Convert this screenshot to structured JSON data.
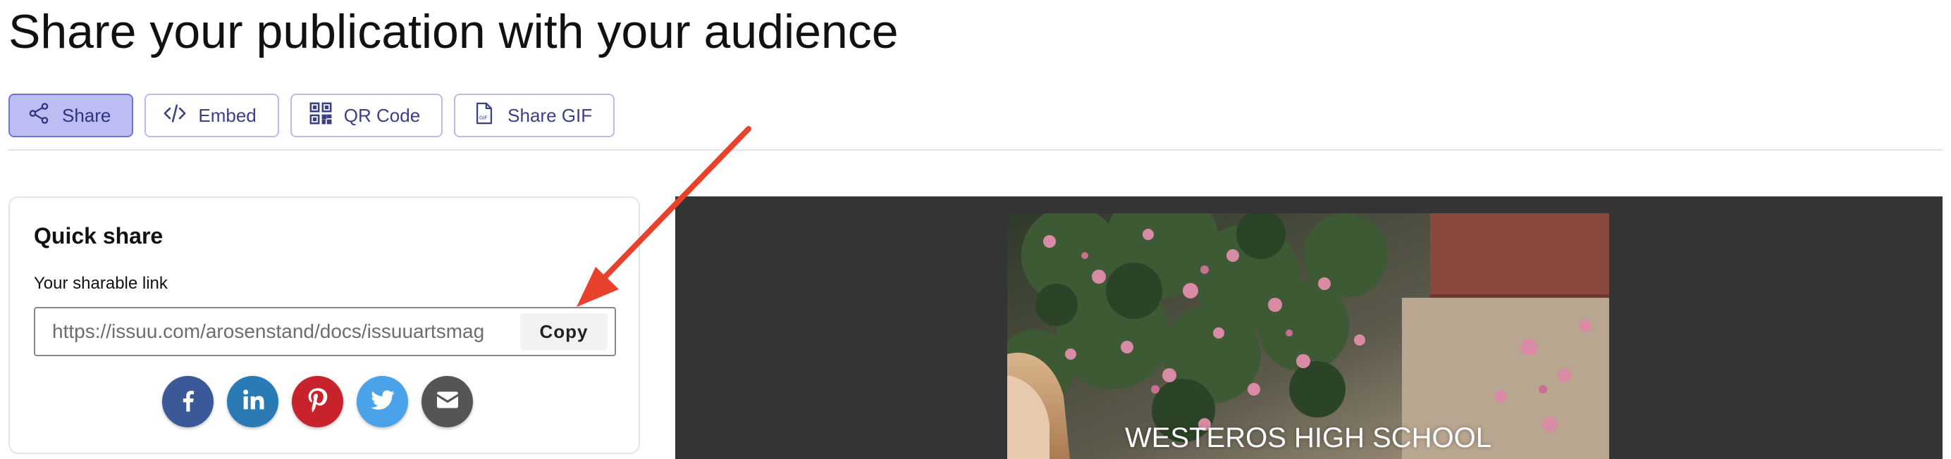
{
  "page": {
    "title": "Share your publication with your audience"
  },
  "tabs": [
    {
      "label": "Share",
      "icon": "share-icon",
      "active": true
    },
    {
      "label": "Embed",
      "icon": "code-icon",
      "active": false
    },
    {
      "label": "QR Code",
      "icon": "qr-code-icon",
      "active": false
    },
    {
      "label": "Share GIF",
      "icon": "gif-file-icon",
      "active": false
    }
  ],
  "quick_share": {
    "title": "Quick share",
    "link_label": "Your sharable link",
    "link_value": "https://issuu.com/arosenstand/docs/issuuartsmag",
    "copy_label": "Copy",
    "socials": [
      {
        "name": "facebook",
        "icon": "facebook-icon",
        "color": "#3b5998"
      },
      {
        "name": "linkedin",
        "icon": "linkedin-icon",
        "color": "#2a7ab5"
      },
      {
        "name": "pinterest",
        "icon": "pinterest-icon",
        "color": "#c8232c"
      },
      {
        "name": "twitter",
        "icon": "twitter-icon",
        "color": "#4aa2e8"
      },
      {
        "name": "email",
        "icon": "email-icon",
        "color": "#555555"
      }
    ]
  },
  "preview": {
    "cover_title": "WESTEROS HIGH SCHOOL"
  },
  "colors": {
    "accent": "#bcbdf3",
    "accent_border": "#6f72d6",
    "arrow": "#e8412c",
    "preview_bg": "#343434"
  }
}
